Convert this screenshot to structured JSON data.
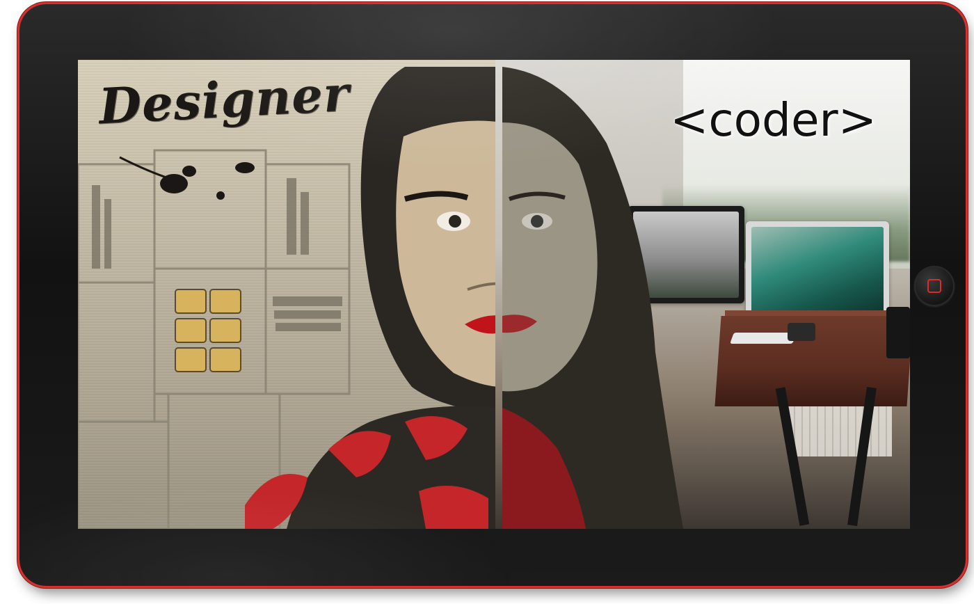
{
  "screen": {
    "left_label": "Designer",
    "right_label": "<coder>"
  },
  "device": {
    "accent_color": "#d8312d",
    "home_icon": "home-square-icon"
  }
}
